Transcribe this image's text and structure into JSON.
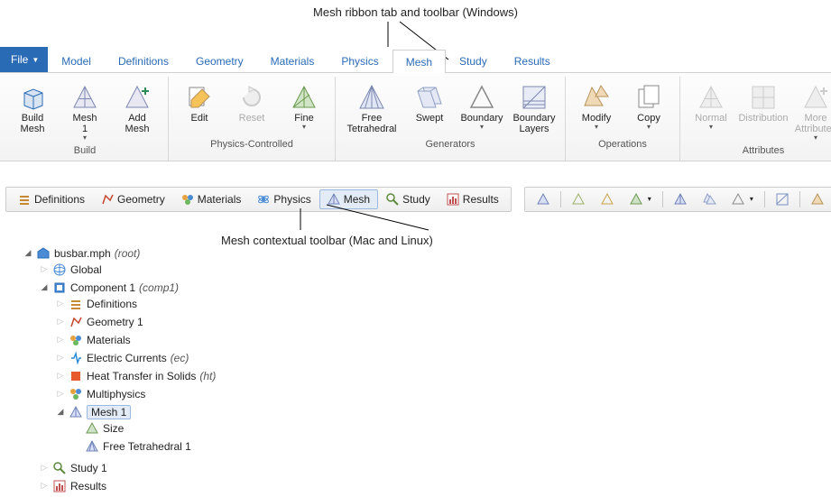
{
  "annotations": {
    "top": "Mesh ribbon tab and toolbar (Windows)",
    "mid": "Mesh contextual toolbar (Mac and Linux)"
  },
  "file_menu": {
    "label": "File"
  },
  "tabs": [
    "Model",
    "Definitions",
    "Geometry",
    "Materials",
    "Physics",
    "Mesh",
    "Study",
    "Results"
  ],
  "active_tab_index": 5,
  "ribbon_groups": [
    {
      "name": "Build",
      "buttons": [
        {
          "id": "build-mesh",
          "label": "Build\nMesh",
          "icon": "cube"
        },
        {
          "id": "mesh-1",
          "label": "Mesh\n1",
          "icon": "tri",
          "dropdown": true
        },
        {
          "id": "add-mesh",
          "label": "Add\nMesh",
          "icon": "tri-plus"
        }
      ]
    },
    {
      "name": "Physics-Controlled",
      "buttons": [
        {
          "id": "edit",
          "label": "Edit",
          "icon": "edit"
        },
        {
          "id": "reset",
          "label": "Reset",
          "icon": "reset",
          "disabled": true
        },
        {
          "id": "fine",
          "label": "Fine",
          "icon": "tri-green",
          "dropdown": true
        }
      ]
    },
    {
      "name": "Generators",
      "buttons": [
        {
          "id": "free-tet",
          "label": "Free\nTetrahedral",
          "icon": "tet",
          "wide": true
        },
        {
          "id": "swept",
          "label": "Swept",
          "icon": "swept"
        },
        {
          "id": "boundary",
          "label": "Boundary",
          "icon": "btri",
          "dropdown": true
        },
        {
          "id": "boundary-layers",
          "label": "Boundary\nLayers",
          "icon": "blayers"
        }
      ]
    },
    {
      "name": "Operations",
      "buttons": [
        {
          "id": "modify",
          "label": "Modify",
          "icon": "modify",
          "dropdown": true
        },
        {
          "id": "copy",
          "label": "Copy",
          "icon": "copy",
          "dropdown": true
        }
      ]
    },
    {
      "name": "Attributes",
      "buttons": [
        {
          "id": "normal",
          "label": "Normal",
          "icon": "tri",
          "disabled": true,
          "dropdown": true
        },
        {
          "id": "distribution",
          "label": "Distribution",
          "icon": "grid",
          "disabled": true
        },
        {
          "id": "more-attr",
          "label": "More\nAttributes",
          "icon": "tri-plus",
          "disabled": true,
          "dropdown": true
        }
      ]
    }
  ],
  "ctx_buttons": [
    {
      "id": "definitions",
      "label": "Definitions",
      "icon": "defs"
    },
    {
      "id": "geometry",
      "label": "Geometry",
      "icon": "geom"
    },
    {
      "id": "materials",
      "label": "Materials",
      "icon": "mat"
    },
    {
      "id": "physics",
      "label": "Physics",
      "icon": "phys"
    },
    {
      "id": "mesh",
      "label": "Mesh",
      "icon": "meshtri",
      "selected": true
    },
    {
      "id": "study",
      "label": "Study",
      "icon": "study"
    },
    {
      "id": "results",
      "label": "Results",
      "icon": "results"
    }
  ],
  "tree": {
    "root": {
      "label": "busbar.mph",
      "suffix": "(root)",
      "icon": "rootdoc",
      "expanded": true,
      "children": [
        {
          "label": "Global",
          "icon": "globe",
          "expanded": false,
          "children": []
        },
        {
          "label": "Component 1",
          "suffix": "(comp1)",
          "icon": "comp",
          "expanded": true,
          "children": [
            {
              "label": "Definitions",
              "icon": "defs",
              "expanded": false,
              "children": []
            },
            {
              "label": "Geometry 1",
              "icon": "geom",
              "expanded": false,
              "children": []
            },
            {
              "label": "Materials",
              "icon": "mat",
              "expanded": false,
              "children": []
            },
            {
              "label": "Electric Currents",
              "suffix": "(ec)",
              "icon": "ec",
              "expanded": false,
              "children": []
            },
            {
              "label": "Heat Transfer in Solids",
              "suffix": "(ht)",
              "icon": "ht",
              "expanded": false,
              "children": []
            },
            {
              "label": "Multiphysics",
              "icon": "multi",
              "expanded": false,
              "children": []
            },
            {
              "label": "Mesh 1",
              "icon": "meshtri",
              "expanded": true,
              "selected": true,
              "children": [
                {
                  "label": "Size",
                  "icon": "size"
                },
                {
                  "label": "Free Tetrahedral 1",
                  "icon": "ftet"
                }
              ]
            }
          ]
        },
        {
          "label": "Study 1",
          "icon": "study",
          "expanded": false,
          "children": []
        },
        {
          "label": "Results",
          "icon": "results",
          "expanded": false,
          "children": []
        }
      ]
    }
  }
}
